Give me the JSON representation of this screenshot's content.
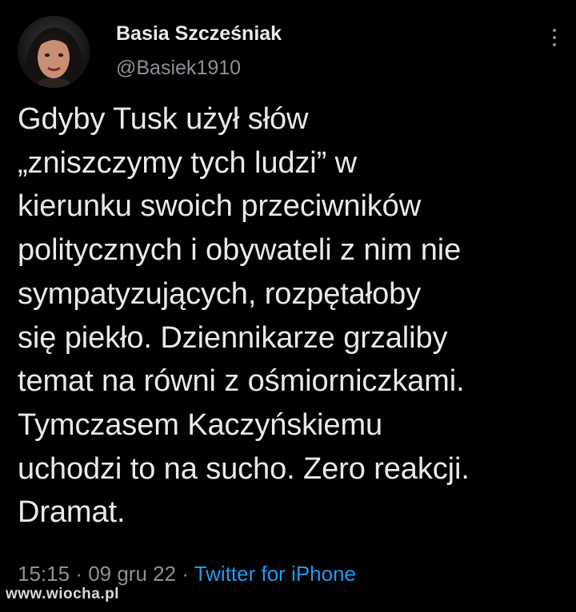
{
  "author": {
    "name": "Basia Szcześniak",
    "handle": "@Basiek1910"
  },
  "icons": {
    "avatar": "profile-photo",
    "more": "more-vertical-icon"
  },
  "tweet": {
    "lines": [
      "Gdyby Tusk użył słów",
      "„zniszczymy tych ludzi” w",
      "kierunku swoich przeciwników",
      "politycznych i obywateli z nim nie",
      "sympatyzujących, rozpętałoby",
      "się piekło. Dziennikarze grzaliby",
      "temat na równi z ośmiorniczkami.",
      "Tymczasem Kaczyńskiemu",
      "uchodzi to na sucho. Zero reakcji.",
      "Dramat."
    ]
  },
  "meta": {
    "time": "15:15",
    "separator": " · ",
    "date": "09 gru 22",
    "source": "Twitter for iPhone"
  },
  "watermark": "www.wiocha.pl",
  "colors": {
    "background": "#000000",
    "text": "#e7e9ea",
    "secondary": "#8b9096",
    "link": "#1d9bf0"
  }
}
